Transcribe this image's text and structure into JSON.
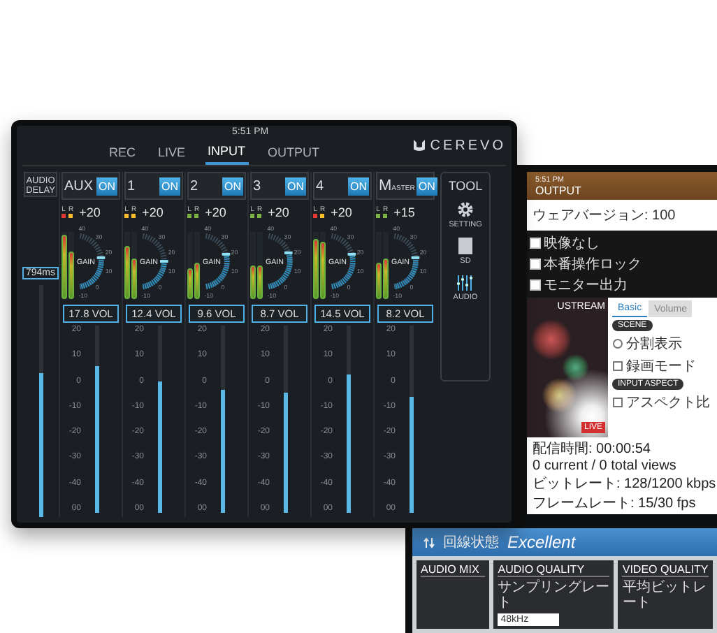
{
  "mixer": {
    "status_time": "5:51 PM",
    "brand": "CEREVO",
    "tabs": [
      {
        "label": "REC",
        "selected": false
      },
      {
        "label": "LIVE",
        "selected": false
      },
      {
        "label": "INPUT",
        "selected": true
      },
      {
        "label": "OUTPUT",
        "selected": false
      }
    ],
    "audio_delay": {
      "label": "AUDIO DELAY",
      "value": "794ms",
      "level": 0.62
    },
    "channels": [
      {
        "name": "AUX",
        "kind": "input",
        "on": true,
        "on_label": "ON",
        "peaks": [
          {
            "label": "L",
            "color": "#e53935"
          },
          {
            "label": "R",
            "color": "#fbc02d"
          }
        ],
        "gain": "+20",
        "meters": [
          {
            "level": 0.95
          },
          {
            "level": 0.7
          }
        ],
        "knob": {
          "label": "GAIN",
          "level": 0.55,
          "ticks": [
            "40",
            "30",
            "20",
            "10",
            "0",
            "-10"
          ]
        },
        "fader": {
          "reading": "17.8 VOL",
          "level": 0.78,
          "ticks": [
            "20",
            "10",
            "0",
            "-10",
            "-20",
            "-30",
            "-40",
            "00"
          ]
        }
      },
      {
        "name": "1",
        "kind": "input",
        "on": true,
        "on_label": "ON",
        "peaks": [
          {
            "label": "L",
            "color": "#fbc02d"
          },
          {
            "label": "R",
            "color": "#fbc02d"
          }
        ],
        "gain": "+20",
        "meters": [
          {
            "level": 0.8
          },
          {
            "level": 0.6
          }
        ],
        "knob": {
          "label": "GAIN",
          "level": 0.5,
          "ticks": [
            "40",
            "30",
            "20",
            "10",
            "0",
            "-10"
          ]
        },
        "fader": {
          "reading": "12.4 VOL",
          "level": 0.7,
          "ticks": [
            "20",
            "10",
            "0",
            "-10",
            "-20",
            "-30",
            "-40",
            "00"
          ]
        }
      },
      {
        "name": "2",
        "kind": "input",
        "on": true,
        "on_label": "ON",
        "peaks": [
          {
            "label": "L",
            "color": "#7cb342"
          },
          {
            "label": "R",
            "color": "#7cb342"
          }
        ],
        "gain": "+20",
        "meters": [
          {
            "level": 0.45
          },
          {
            "level": 0.55
          }
        ],
        "knob": {
          "label": "GAIN",
          "level": 0.6,
          "ticks": [
            "40",
            "30",
            "20",
            "10",
            "0",
            "-10"
          ]
        },
        "fader": {
          "reading": "9.6 VOL",
          "level": 0.66,
          "ticks": [
            "20",
            "10",
            "0",
            "-10",
            "-20",
            "-30",
            "-40",
            "00"
          ]
        }
      },
      {
        "name": "3",
        "kind": "input",
        "on": true,
        "on_label": "ON",
        "peaks": [
          {
            "label": "L",
            "color": "#7cb342"
          },
          {
            "label": "R",
            "color": "#7cb342"
          }
        ],
        "gain": "+20",
        "meters": [
          {
            "level": 0.5
          },
          {
            "level": 0.5
          }
        ],
        "knob": {
          "label": "GAIN",
          "level": 0.62,
          "ticks": [
            "40",
            "30",
            "20",
            "10",
            "0",
            "-10"
          ]
        },
        "fader": {
          "reading": "8.7 VOL",
          "level": 0.64,
          "ticks": [
            "20",
            "10",
            "0",
            "-10",
            "-20",
            "-30",
            "-40",
            "00"
          ]
        }
      },
      {
        "name": "4",
        "kind": "input",
        "on": true,
        "on_label": "ON",
        "peaks": [
          {
            "label": "L",
            "color": "#e53935"
          },
          {
            "label": "R",
            "color": "#fbc02d"
          }
        ],
        "gain": "+20",
        "meters": [
          {
            "level": 0.9
          },
          {
            "level": 0.85
          }
        ],
        "knob": {
          "label": "GAIN",
          "level": 0.6,
          "ticks": [
            "40",
            "30",
            "20",
            "10",
            "0",
            "-10"
          ]
        },
        "fader": {
          "reading": "14.5 VOL",
          "level": 0.74,
          "ticks": [
            "20",
            "10",
            "0",
            "-10",
            "-20",
            "-30",
            "-40",
            "00"
          ]
        }
      },
      {
        "name": "MASTER",
        "kind": "master",
        "on": true,
        "on_label": "ON",
        "peaks": [
          {
            "label": "L",
            "color": "#7cb342"
          },
          {
            "label": "R",
            "color": "#7cb342"
          }
        ],
        "gain": "+15",
        "meters": [
          {
            "level": 0.55
          },
          {
            "level": 0.6
          }
        ],
        "knob": {
          "label": "GAIN",
          "level": 0.55,
          "ticks": [
            "40",
            "30",
            "20",
            "10",
            "0",
            "-10"
          ]
        },
        "fader": {
          "reading": "8.2 VOL",
          "level": 0.62,
          "ticks": [
            "20",
            "10",
            "0",
            "-10",
            "-20",
            "-30",
            "-40",
            "00"
          ]
        }
      }
    ],
    "tool": {
      "title": "TOOL",
      "items": [
        {
          "label": "SETTING",
          "kind": "gear"
        },
        {
          "label": "SD",
          "kind": "card"
        },
        {
          "label": "AUDIO",
          "kind": "sliders"
        }
      ]
    }
  },
  "output": {
    "status_time": "5:51 PM",
    "title": "OUTPUT",
    "firmware": "ウェアバージョン: 100",
    "options": [
      {
        "label": "映像なし",
        "checked": false
      },
      {
        "label": "本番操作ロック",
        "checked": false
      },
      {
        "label": "モニター出力",
        "checked": false
      }
    ],
    "video": {
      "channel": "USTREAM",
      "badge": "LIVE"
    },
    "tabs": [
      {
        "label": "Basic",
        "selected": true
      },
      {
        "label": "Volume",
        "selected": false
      }
    ],
    "sections": [
      {
        "title": "SCENE",
        "items": [
          {
            "label": "分割表示",
            "kind": "radio"
          },
          {
            "label": "録画モード",
            "kind": "checkbox"
          }
        ]
      },
      {
        "title": "INPUT ASPECT",
        "items": [
          {
            "label": "アスペクト比",
            "kind": "checkbox"
          }
        ]
      }
    ],
    "stats": [
      "配信時間: 00:00:54",
      "0 current / 0 total views",
      "ビットレート: 128/1200 kbps",
      "フレームレート: 15/30 fps"
    ],
    "connection": {
      "label": "回線状態",
      "value": "Excellent"
    },
    "panels": [
      {
        "title": "AUDIO MIX"
      },
      {
        "title": "AUDIO QUALITY",
        "field_label": "サンプリングレート",
        "field_value": "48kHz"
      },
      {
        "title": "VIDEO QUALITY",
        "field_label": "平均ビットレート"
      }
    ]
  }
}
